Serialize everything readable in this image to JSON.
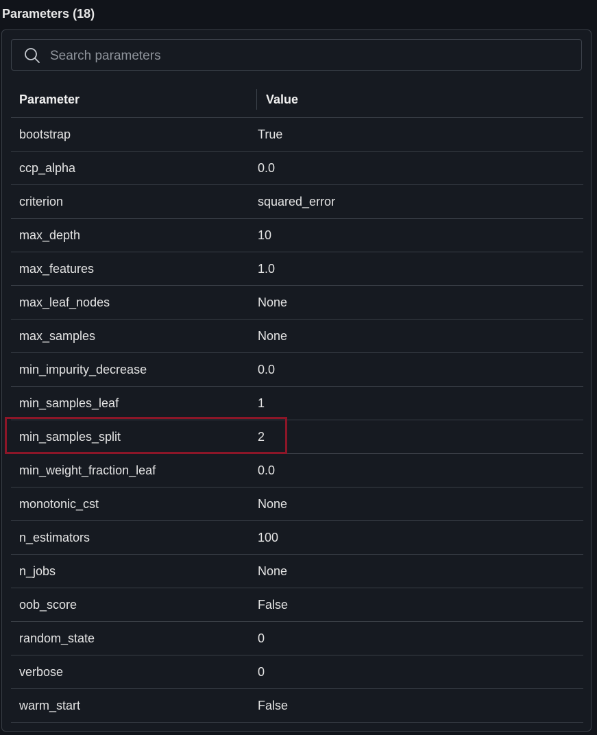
{
  "header": {
    "title": "Parameters (18)"
  },
  "search": {
    "placeholder": "Search parameters",
    "value": ""
  },
  "table": {
    "columns": [
      "Parameter",
      "Value"
    ],
    "rows": [
      {
        "name": "bootstrap",
        "value": "True"
      },
      {
        "name": "ccp_alpha",
        "value": "0.0"
      },
      {
        "name": "criterion",
        "value": "squared_error"
      },
      {
        "name": "max_depth",
        "value": "10"
      },
      {
        "name": "max_features",
        "value": "1.0"
      },
      {
        "name": "max_leaf_nodes",
        "value": "None"
      },
      {
        "name": "max_samples",
        "value": "None"
      },
      {
        "name": "min_impurity_decrease",
        "value": "0.0"
      },
      {
        "name": "min_samples_leaf",
        "value": "1"
      },
      {
        "name": "min_samples_split",
        "value": "2"
      },
      {
        "name": "min_weight_fraction_leaf",
        "value": "0.0"
      },
      {
        "name": "monotonic_cst",
        "value": "None"
      },
      {
        "name": "n_estimators",
        "value": "100"
      },
      {
        "name": "n_jobs",
        "value": "None"
      },
      {
        "name": "oob_score",
        "value": "False"
      },
      {
        "name": "random_state",
        "value": "0"
      },
      {
        "name": "verbose",
        "value": "0"
      },
      {
        "name": "warm_start",
        "value": "False"
      }
    ]
  },
  "highlight": {
    "row_name": "min_samples_split",
    "color": "#8c1628"
  }
}
